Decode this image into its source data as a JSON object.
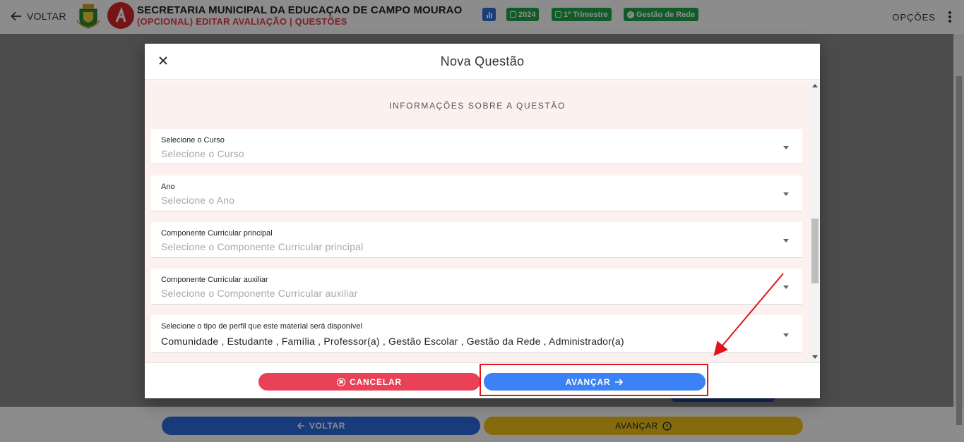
{
  "header": {
    "back_label": "VOLTAR",
    "title": "SECRETARIA MUNICIPAL DA EDUCAÇAO DE CAMPO MOURAO",
    "subtitle": "(OPCIONAL) EDITAR AVALIAÇÃO | QUESTÕES",
    "chips": {
      "year": "2024",
      "term": "1º Trimestre",
      "scope": "Gestão de Rede"
    },
    "options_label": "OPÇÕES",
    "icons": [
      "arrow-left-icon",
      "crest-icon",
      "logo-icon",
      "chart-icon",
      "calendar-icon",
      "check-circle-icon",
      "kebab-icon"
    ]
  },
  "bottom": {
    "back_label": "VOLTAR",
    "next_label": "AVANÇAR"
  },
  "modal": {
    "title": "Nova Questão",
    "section_title": "INFORMAÇÕES SOBRE A QUESTÃO",
    "fields": [
      {
        "label": "Selecione o Curso",
        "value": "Selecione o Curso"
      },
      {
        "label": "Ano",
        "value": "Selecione o Ano"
      },
      {
        "label": "Componente Curricular principal",
        "value": "Selecione o Componente Curricular principal"
      },
      {
        "label": "Componente Curricular auxiliar",
        "value": "Selecione o Componente Curricular auxiliar"
      },
      {
        "label": "Selecione o tipo de perfil que este material será disponível",
        "value": "Comunidade , Estudante , Família , Professor(a) , Gestão Escolar , Gestão da Rede , Administrador(a)"
      }
    ],
    "cancel_label": "CANCELAR",
    "next_label": "AVANÇAR"
  },
  "colors": {
    "cancel": "#e94157",
    "next": "#3b82f6",
    "annotation": "#e3121b",
    "accent_red": "#e63e4c",
    "chip_green": "#20a64a"
  }
}
